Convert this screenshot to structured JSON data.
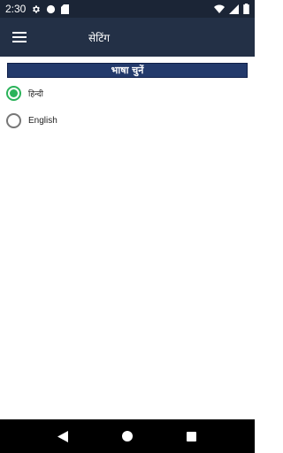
{
  "status_bar": {
    "time": "2:30",
    "icons": [
      "gear-icon",
      "circle-icon",
      "sd-card-icon",
      "wifi-icon",
      "signal-icon",
      "battery-icon"
    ]
  },
  "app_bar": {
    "title": "सेटिंग",
    "menu_icon": "hamburger-menu-icon"
  },
  "language_section": {
    "header": "भाषा चुनें",
    "options": [
      {
        "label": "हिन्दी",
        "selected": true
      },
      {
        "label": "English",
        "selected": false
      }
    ]
  },
  "nav_bar": {
    "icons": [
      "back-icon",
      "home-icon",
      "recents-icon"
    ]
  },
  "colors": {
    "status_bar": "#1b2536",
    "app_bar": "#233046",
    "section_header": "#233a6b",
    "radio_selected": "#2bb35a",
    "radio_unselected": "#777777"
  }
}
